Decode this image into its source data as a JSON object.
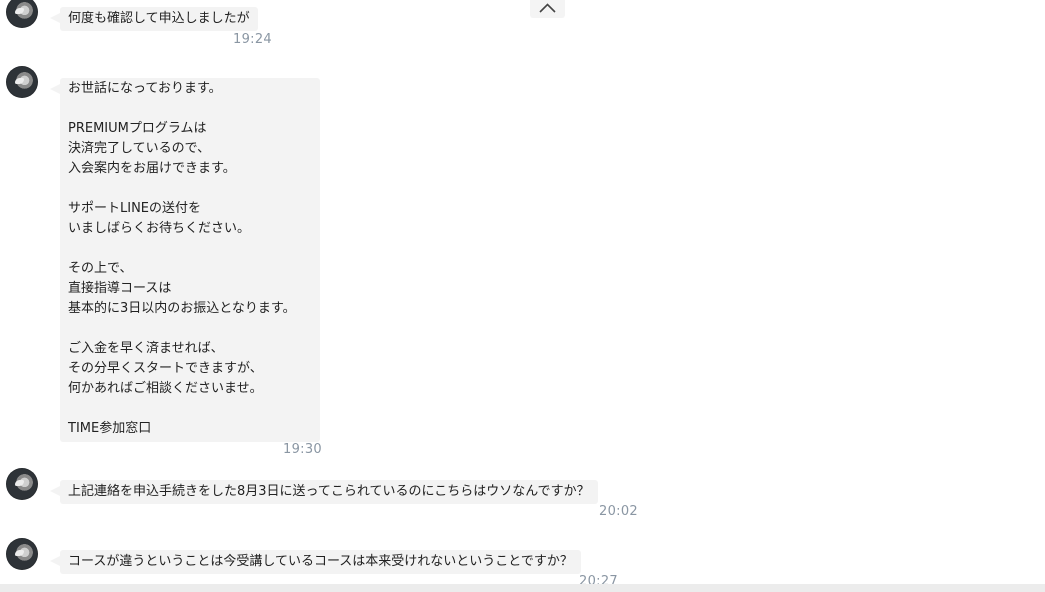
{
  "messages": [
    {
      "text": "何度も確認して申込しましたが",
      "time": "19:24"
    },
    {
      "text": "お世話になっております。\n\nPREMIUMプログラムは\n決済完了しているので、\n入会案内をお届けできます。\n\nサポートLINEの送付を\nいましばらくお待ちください。\n\nその上で、\n直接指導コースは\n基本的に3日以内のお振込となります。\n\nご入金を早く済ませれば、\nその分早くスタートできますが、\n何かあればご相談くださいませ。\n\nTIME参加窓口",
      "time": "19:30"
    },
    {
      "text": "上記連絡を申込手続きをした8月3日に送ってこられているのにこちらはウソなんですか？",
      "time": "20:02"
    },
    {
      "text": "コースが違うということは今受講しているコースは本来受けれないということですか？",
      "time": "20:27"
    }
  ],
  "icons": {
    "scroll_up": "chevron-up-icon",
    "avatar": "owl-avatar"
  }
}
